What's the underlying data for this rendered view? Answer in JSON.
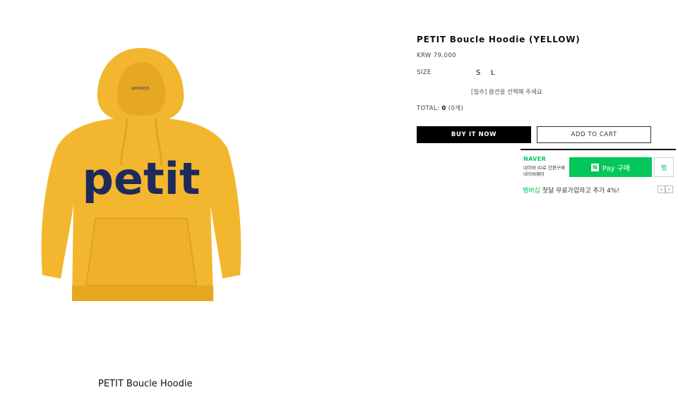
{
  "product": {
    "title": "PETIT Boucle Hoodie (YELLOW)",
    "price": "KRW 79,000",
    "image_text": "petit",
    "caption": "PETIT Boucle Hoodie"
  },
  "options": {
    "size_label": "SIZE",
    "sizes": [
      "S",
      "L"
    ],
    "required_text": "[필수] 옵션을 선택해 주세요"
  },
  "total": {
    "label": "TOTAL:",
    "amount": "0",
    "count": "(0개)"
  },
  "buttons": {
    "buy_now": "BUY IT NOW",
    "add_to_cart": "ADD TO CART"
  },
  "naver_pay": {
    "brand": "NAVER",
    "line1": "네이버 ID로 간편구매",
    "line2": "네이버페이",
    "pay_icon": "N",
    "pay_label": "Pay 구매",
    "wish_label": "찜"
  },
  "promo": {
    "highlight": "멤버십",
    "text": " 첫달 무료가입하고 추가 4%!",
    "prev_icon": "‹",
    "next_icon": "›"
  },
  "colors": {
    "hoodie": "#F2B72E",
    "lettering": "#1F2A5C",
    "naver_green": "#03C75A"
  }
}
